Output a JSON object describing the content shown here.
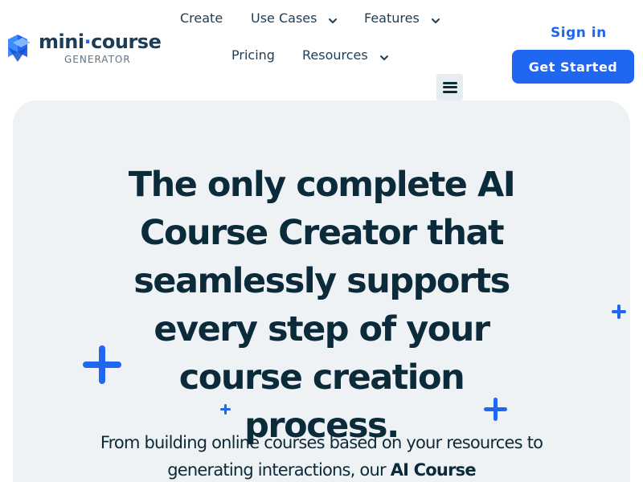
{
  "logo": {
    "main_left": "mini",
    "dot": "·",
    "main_right": "course",
    "sub": "GENERATOR"
  },
  "nav": {
    "create": "Create",
    "use_cases": "Use Cases",
    "features": "Features",
    "pricing": "Pricing",
    "resources": "Resources"
  },
  "actions": {
    "sign_in": "Sign in",
    "get_started": "Get Started"
  },
  "hero": {
    "title": "The only complete AI Course Creator that seamlessly supports every step of your course creation process.",
    "subtitle_lead": "From building online courses based on your resources to generating interactions, our ",
    "subtitle_bold": "AI Course"
  },
  "colors": {
    "accent": "#1f66f0",
    "heading": "#0b2a3a",
    "hero_bg": "#eef2f5"
  },
  "icons": {
    "menu": "hamburger-menu-icon",
    "chevron": "chevron-down-icon",
    "plus": "plus-icon"
  }
}
